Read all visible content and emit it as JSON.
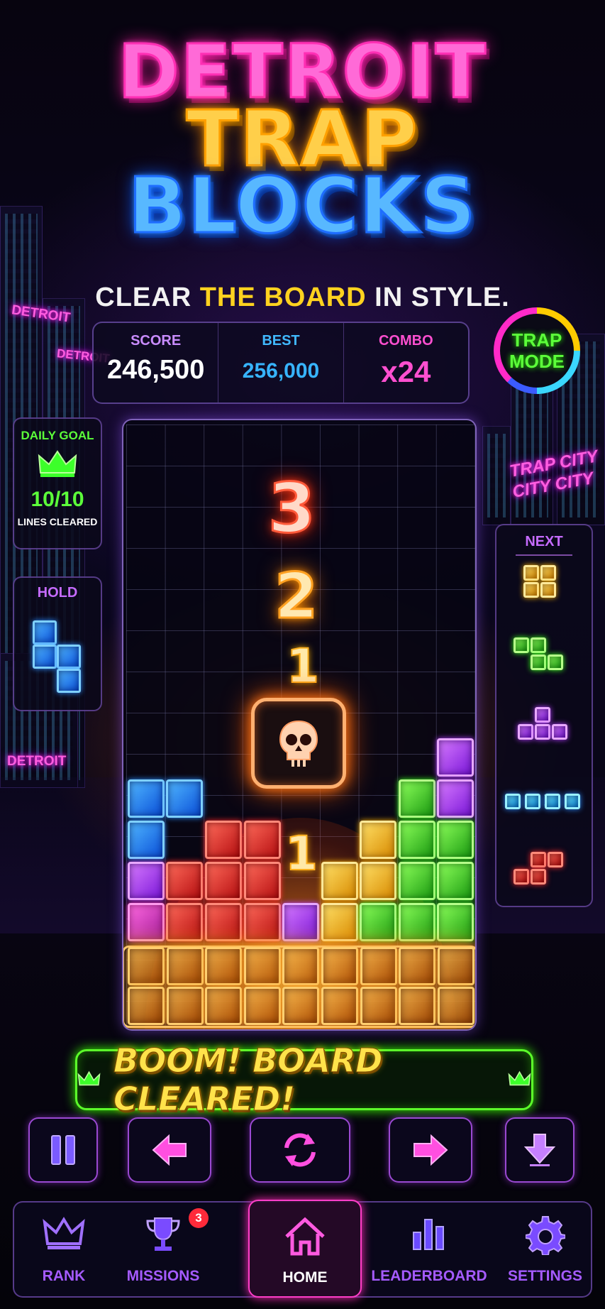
{
  "game": {
    "title_lines": [
      "DETROIT",
      "TRAP",
      "BLOCKS"
    ],
    "tagline": {
      "part1": "CLEAR ",
      "highlight": "THE BOARD",
      "part2": " IN STYLE."
    }
  },
  "stats": {
    "score": {
      "label": "SCORE",
      "value": "246,500"
    },
    "best": {
      "label": "BEST",
      "value": "256,000"
    },
    "combo": {
      "label": "COMBO",
      "value": "x24"
    }
  },
  "mode_badge": {
    "line1": "TRAP",
    "line2": "MODE",
    "ring_colors": [
      "#ffcc00",
      "#3ad7ff",
      "#3b5bff",
      "#ff2ac8"
    ]
  },
  "daily_goal": {
    "label": "DAILY GOAL",
    "value": "10/10",
    "sub": "LINES CLEARED",
    "icon": "crown-icon"
  },
  "hold": {
    "label": "HOLD",
    "piece": "S-blue"
  },
  "next": {
    "label": "NEXT",
    "pieces": [
      "O-yellow",
      "Z-green",
      "T-purple",
      "I-cyan",
      "S-red"
    ]
  },
  "background_signs": [
    "DETROIT",
    "DETROIT",
    "DETROIT",
    "TRAP CITY",
    "CITY CITY"
  ],
  "board": {
    "countdown": [
      "3",
      "2",
      "1"
    ],
    "center_icon": "skull-icon",
    "combo_marker": "1"
  },
  "banner": {
    "text": "BOOM! BOARD CLEARED!"
  },
  "controls": [
    {
      "name": "pause-button",
      "icon": "pause-icon"
    },
    {
      "name": "move-left-button",
      "icon": "arrow-left-icon"
    },
    {
      "name": "rotate-button",
      "icon": "rotate-icon"
    },
    {
      "name": "move-right-button",
      "icon": "arrow-right-icon"
    },
    {
      "name": "drop-button",
      "icon": "arrow-down-icon"
    }
  ],
  "nav": {
    "items": [
      {
        "label": "RANK",
        "icon": "crown-icon"
      },
      {
        "label": "MISSIONS",
        "icon": "trophy-icon",
        "badge": "3"
      },
      {
        "label": "HOME",
        "icon": "home-icon",
        "active": true
      },
      {
        "label": "LEADERBOARD",
        "icon": "bar-chart-icon"
      },
      {
        "label": "SETTINGS",
        "icon": "gear-icon"
      }
    ]
  },
  "colors": {
    "pink": "#ff4fd0",
    "yellow": "#ffd21f",
    "blue": "#37b4ff",
    "green": "#5cff3a",
    "purple": "#a55bff"
  }
}
